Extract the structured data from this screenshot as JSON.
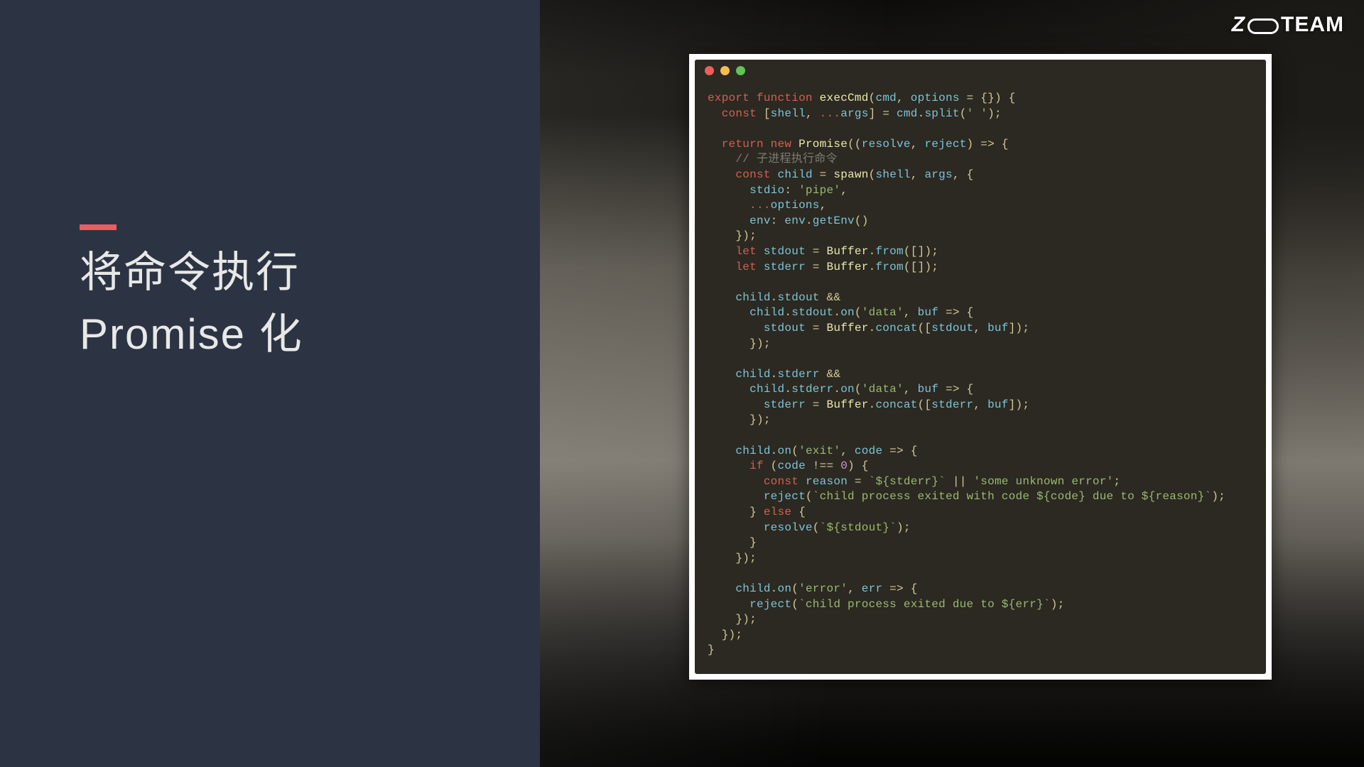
{
  "brand": {
    "text_left": "Z",
    "text_right": " TEAM"
  },
  "title": {
    "line1": "将命令执行",
    "line2": "Promise 化"
  },
  "window": {
    "buttons": [
      "close",
      "minimize",
      "zoom"
    ]
  },
  "code": {
    "lang": "javascript",
    "function_name": "execCmd",
    "comment": "子进程执行命令",
    "tokens": {
      "export": "export",
      "function": "function",
      "const": "const",
      "return": "return",
      "new": "new",
      "let": "let",
      "if": "if",
      "else": "else",
      "spread": "..."
    },
    "idents": {
      "cmd": "cmd",
      "options": "options",
      "shell": "shell",
      "args": "args",
      "split": "split",
      "Promise": "Promise",
      "resolve": "resolve",
      "reject": "reject",
      "child": "child",
      "spawn": "spawn",
      "stdio": "stdio",
      "env": "env",
      "getEnv": "getEnv",
      "stdout": "stdout",
      "stderr": "stderr",
      "Buffer": "Buffer",
      "from": "from",
      "on": "on",
      "buf": "buf",
      "concat": "concat",
      "code": "code",
      "reason": "reason",
      "err": "err"
    },
    "strings": {
      "space": "' '",
      "pipe": "'pipe'",
      "data": "'data'",
      "exit": "'exit'",
      "error": "'error'",
      "unknown": "'some unknown error'"
    },
    "templates": {
      "stderr_tpl": "`${stderr}`",
      "reject_exit": "`child process exited with code ${code} due to ${reason}`",
      "resolve_tpl": "`${stdout}`",
      "reject_err": "`child process exited due to ${err}`"
    },
    "literals": {
      "empty_obj": "{}",
      "zero": "0",
      "empty_arr": "[]"
    }
  }
}
